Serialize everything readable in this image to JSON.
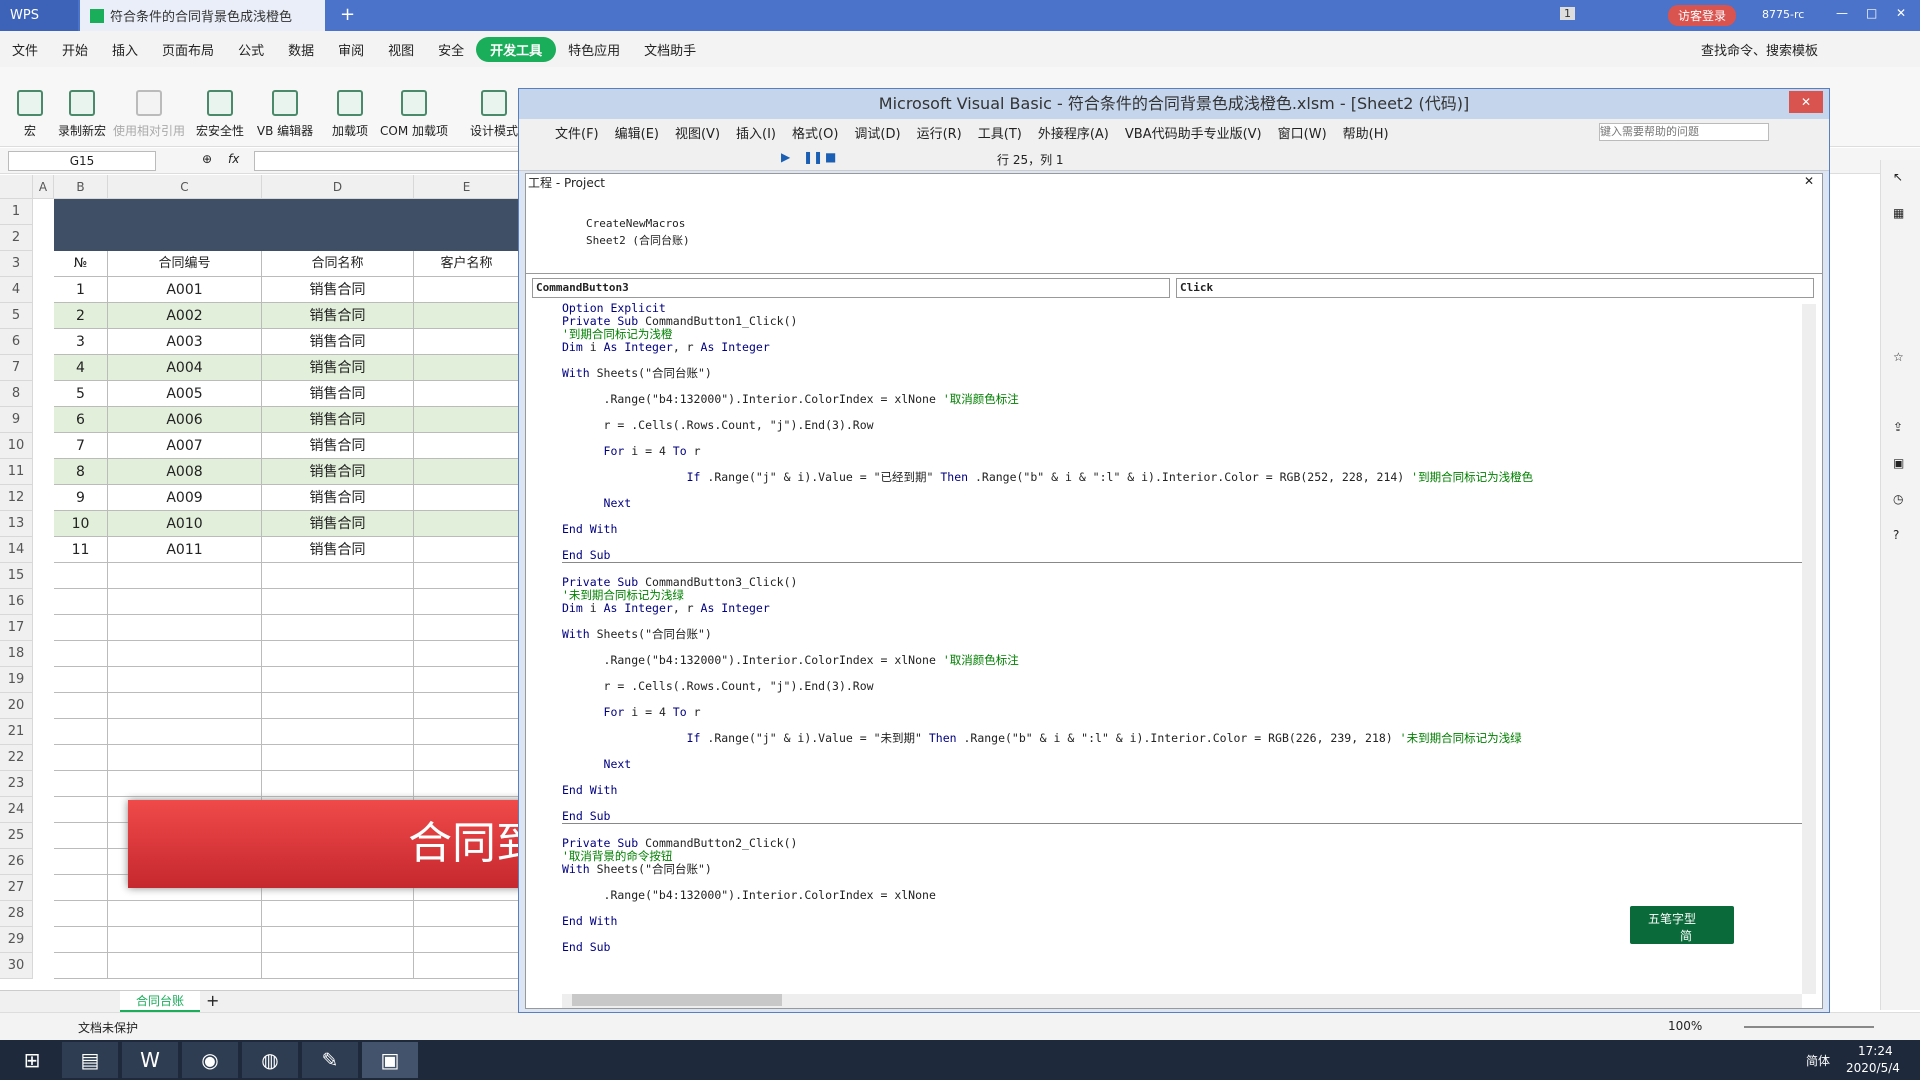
{
  "titlebar": {
    "app_tab": "WPS",
    "doc_tab": "符合条件的合同背景色成浅橙色",
    "badge": "1",
    "login": "访客登录",
    "user_id": "8775-rc"
  },
  "menu": [
    "文件",
    "开始",
    "插入",
    "页面布局",
    "公式",
    "数据",
    "审阅",
    "视图",
    "安全",
    "开发工具",
    "特色应用",
    "文档助手"
  ],
  "menu_search": "查找命令、搜索模板",
  "ribbon": [
    "宏",
    "录制新宏",
    "使用相对引用",
    "宏安全性",
    "VB 编辑器",
    "加载项",
    "COM 加载项",
    "设计模式"
  ],
  "formula": {
    "cell_ref": "G15",
    "fx": "fx"
  },
  "sheet": {
    "cols": [
      "A",
      "B",
      "C",
      "D",
      "E"
    ],
    "headers": [
      "№",
      "合同编号",
      "合同名称",
      "客户名称"
    ],
    "rows": [
      [
        "1",
        "A001",
        "销售合同"
      ],
      [
        "2",
        "A002",
        "销售合同"
      ],
      [
        "3",
        "A003",
        "销售合同"
      ],
      [
        "4",
        "A004",
        "销售合同"
      ],
      [
        "5",
        "A005",
        "销售合同"
      ],
      [
        "6",
        "A006",
        "销售合同"
      ],
      [
        "7",
        "A007",
        "销售合同"
      ],
      [
        "8",
        "A008",
        "销售合同"
      ],
      [
        "9",
        "A009",
        "销售合同"
      ],
      [
        "10",
        "A010",
        "销售合同"
      ],
      [
        "11",
        "A011",
        "销售合同"
      ]
    ],
    "row_numbers": [
      "1",
      "2",
      "3",
      "4",
      "5",
      "6",
      "7",
      "8",
      "9",
      "10",
      "11",
      "12",
      "13",
      "14",
      "15",
      "16",
      "17",
      "18",
      "19",
      "20",
      "21",
      "22",
      "23",
      "24",
      "25",
      "26",
      "27",
      "28",
      "29",
      "30"
    ],
    "button_text": "合同到",
    "tab": "合同台账"
  },
  "status": {
    "protect": "文档未保护",
    "zoom": "100%"
  },
  "vbe": {
    "title": "Microsoft Visual Basic - 符合条件的合同背景色成浅橙色.xlsm - [Sheet2 (代码)]",
    "menu": [
      "文件(F)",
      "编辑(E)",
      "视图(V)",
      "插入(I)",
      "格式(O)",
      "调试(D)",
      "运行(R)",
      "工具(T)",
      "外接程序(A)",
      "VBA代码助手专业版(V)",
      "窗口(W)",
      "帮助(H)"
    ],
    "help_placeholder": "键入需要帮助的问题",
    "position": "行 25，列 1",
    "project_title": "工程 - Project",
    "tree": [
      "CreateNewMacros",
      "Sheet2 (合同台账)"
    ],
    "object_combo": "CommandButton3",
    "proc_combo": "Click"
  },
  "ime": {
    "line1": "五笔字型",
    "line2": "简"
  },
  "clock": {
    "time": "17:24",
    "date": "2020/5/4",
    "lang": "简体"
  }
}
